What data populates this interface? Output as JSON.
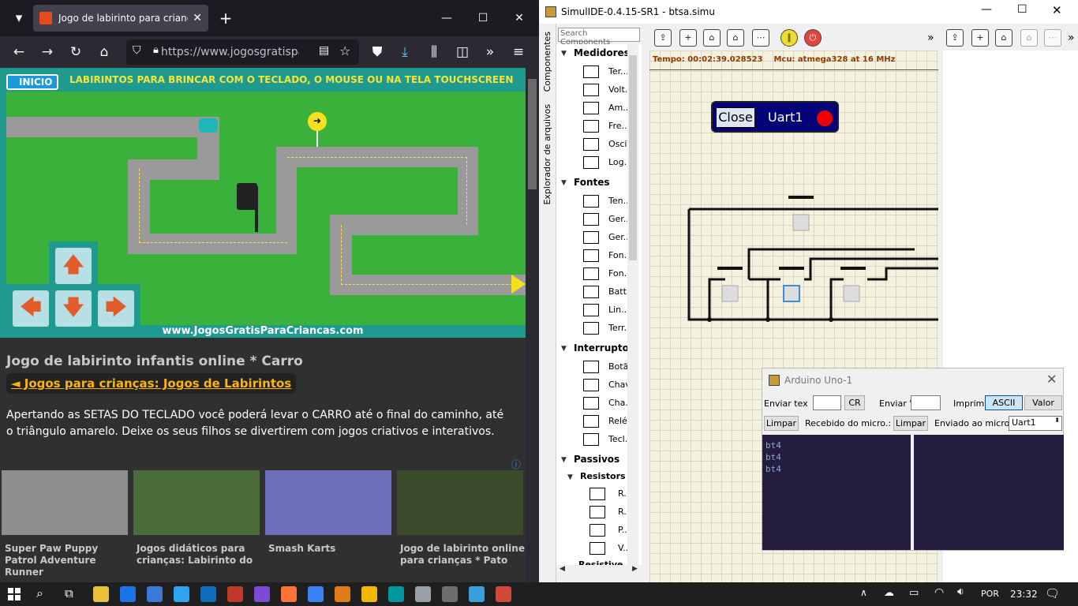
{
  "browser": {
    "tab_title": "Jogo de labirinto para crianças",
    "url": "https://www.jogosgratispara",
    "close_tab_glyph": "✕",
    "new_tab_glyph": "+",
    "icons": [
      "back-icon",
      "forward-icon",
      "reload-icon",
      "home-icon",
      "shield-icon",
      "lock-icon",
      "reader-icon",
      "bookmark-star-icon",
      "pocket-icon",
      "download-icon",
      "library-icon",
      "sidebar-icon",
      "overflow-icon",
      "menu-icon"
    ]
  },
  "game": {
    "inicio": "INICIO",
    "header": "LABIRINTOS PARA BRINCAR COM O TECLADO, O MOUSE OU NA TELA TOUCHSCREEN",
    "footer": "www.JogosGratisParaCriancas.com",
    "keys": {
      "up": "🡅",
      "left": "🡄",
      "down": "🡇",
      "right": "🡆"
    }
  },
  "page": {
    "heading": "Jogo de labirinto infantis online * Carro",
    "back_link": "◄ Jogos para crianças: Jogos de Labirintos",
    "description": "Apertando as SETAS DO TECLADO você poderá levar o CARRO até o final do caminho, até o triângulo amarelo. Deixe os seus filhos se divertirem com jogos criativos e interativos.",
    "ad_marker": "ⓘ",
    "thumbs": [
      {
        "caption": "Super Paw Puppy Patrol Adventure Runner",
        "color": "#8e8e8e"
      },
      {
        "caption": "Jogos didáticos para crianças: Labirinto do",
        "color": "#4a6c3a"
      },
      {
        "caption": "Smash Karts",
        "color": "#6c6fb8"
      },
      {
        "caption": "Jogo de labirinto online para crianças * Pato",
        "color": "#3b4a2a"
      }
    ]
  },
  "simulide": {
    "title": "SimulIDE-0.4.15-SR1  -  btsa.simu",
    "search_placeholder": "Search Components",
    "vtabs": [
      "Componentes",
      "Explorador de arquivos"
    ],
    "categories": [
      {
        "name": "Medidores",
        "items": [
          "Ter...",
          "Volt.",
          "Am...",
          "Fre...",
          "Osci.",
          "Log..."
        ]
      },
      {
        "name": "Fontes",
        "items": [
          "Ten...",
          "Ger..",
          "Ger..",
          "Fon..",
          "Fon..",
          "Batt..",
          "Lin...",
          "Terr.."
        ]
      },
      {
        "name": "Interrupto.",
        "items": [
          "Botã",
          "Chav",
          "Cha..",
          "Relé",
          "Tecl."
        ]
      },
      {
        "name": "Passivos",
        "sub": "Resistors",
        "items": [
          "R..",
          "R..",
          "P..",
          "V.."
        ],
        "more": "Resistive"
      }
    ],
    "status": "Tempo: 00:02:39.028523",
    "mcu": "Mcu: atmega328 at 16 MHz",
    "uart": {
      "close": "Close",
      "name": "Uart1"
    }
  },
  "arduino": {
    "title": "Arduino Uno-1",
    "send_text_label": "Enviar tex",
    "cr_button": "CR",
    "send_label": "Enviar '",
    "print_label": "Imprimi",
    "ascii_button": "ASCII",
    "value_button": "Valor",
    "clear1": "Limpar",
    "received_label": "Recebido do micro.:",
    "clear2": "Limpar",
    "sent_label": "Enviado ao micro.:",
    "uart_select": "Uart1",
    "received_lines": [
      "bt4",
      "bt4",
      "bt4"
    ]
  },
  "taskbar": {
    "language": "POR",
    "time": "23:32",
    "apps": [
      "#e8c03a",
      "#1a73e8",
      "#3c78d8",
      "#2ea3f2",
      "#0f6cbd",
      "#c0392b",
      "#7b4bd6",
      "#ff7139",
      "#3b82f6",
      "#e07b18",
      "#f2b800",
      "#00979d",
      "#9aa0a6",
      "#6d6d6d",
      "#3aa0d8",
      "#d04a3a"
    ]
  }
}
